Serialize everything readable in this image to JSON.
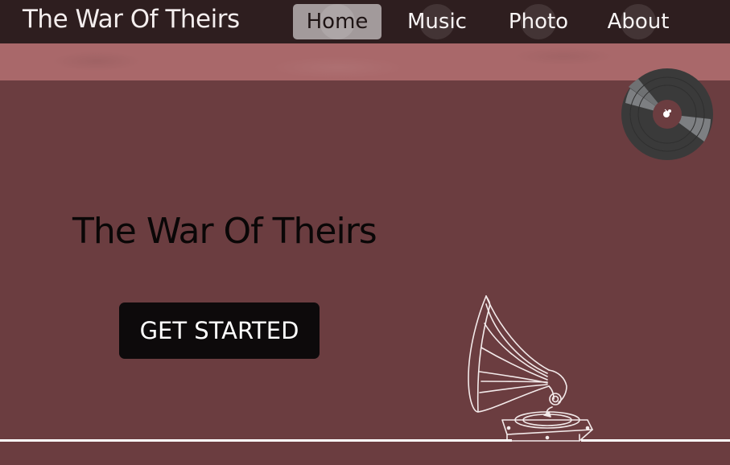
{
  "brand": {
    "title": "The War Of Theirs"
  },
  "nav": {
    "items": [
      {
        "label": "Home",
        "active": true
      },
      {
        "label": "Music",
        "active": false
      },
      {
        "label": "Photo",
        "active": false
      },
      {
        "label": "About",
        "active": false
      }
    ]
  },
  "hero": {
    "title": "The War Of Theirs",
    "cta_label": "GET STARTED"
  },
  "icons": {
    "vinyl": "vinyl-record-icon",
    "gramophone": "gramophone-illustration"
  },
  "colors": {
    "background": "#6b3d40",
    "navbar": "#2e1e1f",
    "banner": "#a9686a",
    "button": "#0d0a0b"
  }
}
